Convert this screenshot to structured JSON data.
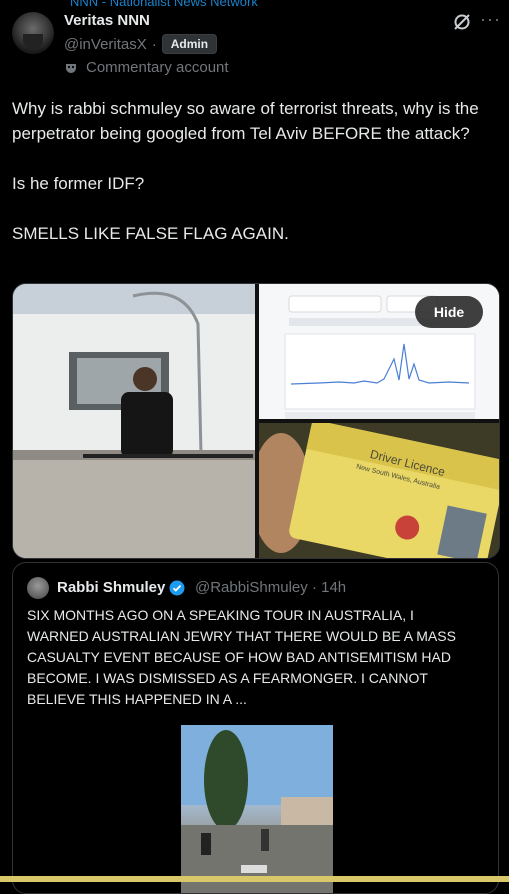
{
  "top_cut_text": "NNN - Nationalist News Network",
  "post": {
    "author_name": "Veritas NNN",
    "handle": "@inVeritasX",
    "separator": "·",
    "badge": "Admin",
    "account_label": "Commentary account",
    "paragraphs": [
      "Why is rabbi schmuley so aware of terrorist threats, why is the perpetrator being googled from Tel Aviv BEFORE the attack?",
      "Is he former IDF?",
      "SMELLS LIKE FALSE FLAG AGAIN."
    ],
    "media_hide_label": "Hide"
  },
  "quoted": {
    "author_name": "Rabbi Shmuley",
    "handle": "@RabbiShmuley",
    "separator": "·",
    "time": "14h",
    "text": "SIX MONTHS AGO ON A SPEAKING TOUR IN AUSTRALIA, I WARNED AUSTRALIAN JEWRY THAT THERE WOULD BE A MASS CASUALTY EVENT BECAUSE OF HOW BAD ANTISEMITISM HAD BECOME. I WAS DISMISSED AS A FEARMONGER. I CANNOT BELIEVE THIS HAPPENED IN A ..."
  },
  "image_texts": {
    "licence_title": "Driver Licence",
    "licence_state": "New South Wales, Australia"
  },
  "icons": {
    "grok": "grok-icon",
    "more": "more-icon",
    "commentary": "mask-icon",
    "verified": "verified-badge-icon"
  },
  "colors": {
    "background": "#000000",
    "text": "#e7e9ea",
    "muted": "#71767b",
    "accent": "#1d9bf0"
  }
}
